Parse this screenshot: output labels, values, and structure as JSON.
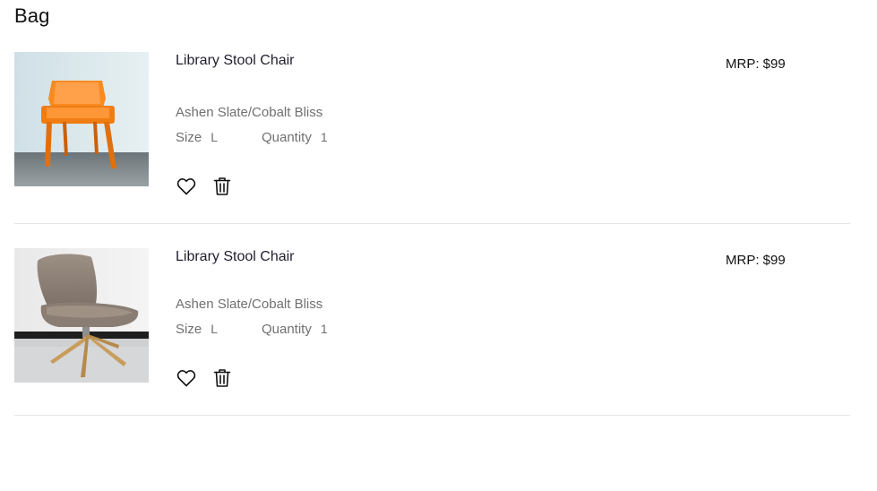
{
  "page": {
    "title": "Bag"
  },
  "items": [
    {
      "name": "Library Stool Chair",
      "price": "MRP: $99",
      "color": "Ashen Slate/Cobalt Bliss",
      "size_label": "Size",
      "size_value": "L",
      "quantity_label": "Quantity",
      "quantity_value": "1",
      "image": "orange-plastic-chair-photo"
    },
    {
      "name": "Library Stool Chair",
      "price": "MRP: $99",
      "color": "Ashen Slate/Cobalt Bliss",
      "size_label": "Size",
      "size_value": "L",
      "quantity_label": "Quantity",
      "quantity_value": "1",
      "image": "grey-swivel-lounge-chair-photo"
    }
  ],
  "icons": {
    "favorite": "heart-icon",
    "remove": "trash-icon"
  },
  "colors": {
    "text_primary": "#111111",
    "text_secondary": "#707072",
    "divider": "#e5e5e5",
    "orange_chair": "#f7861e"
  }
}
